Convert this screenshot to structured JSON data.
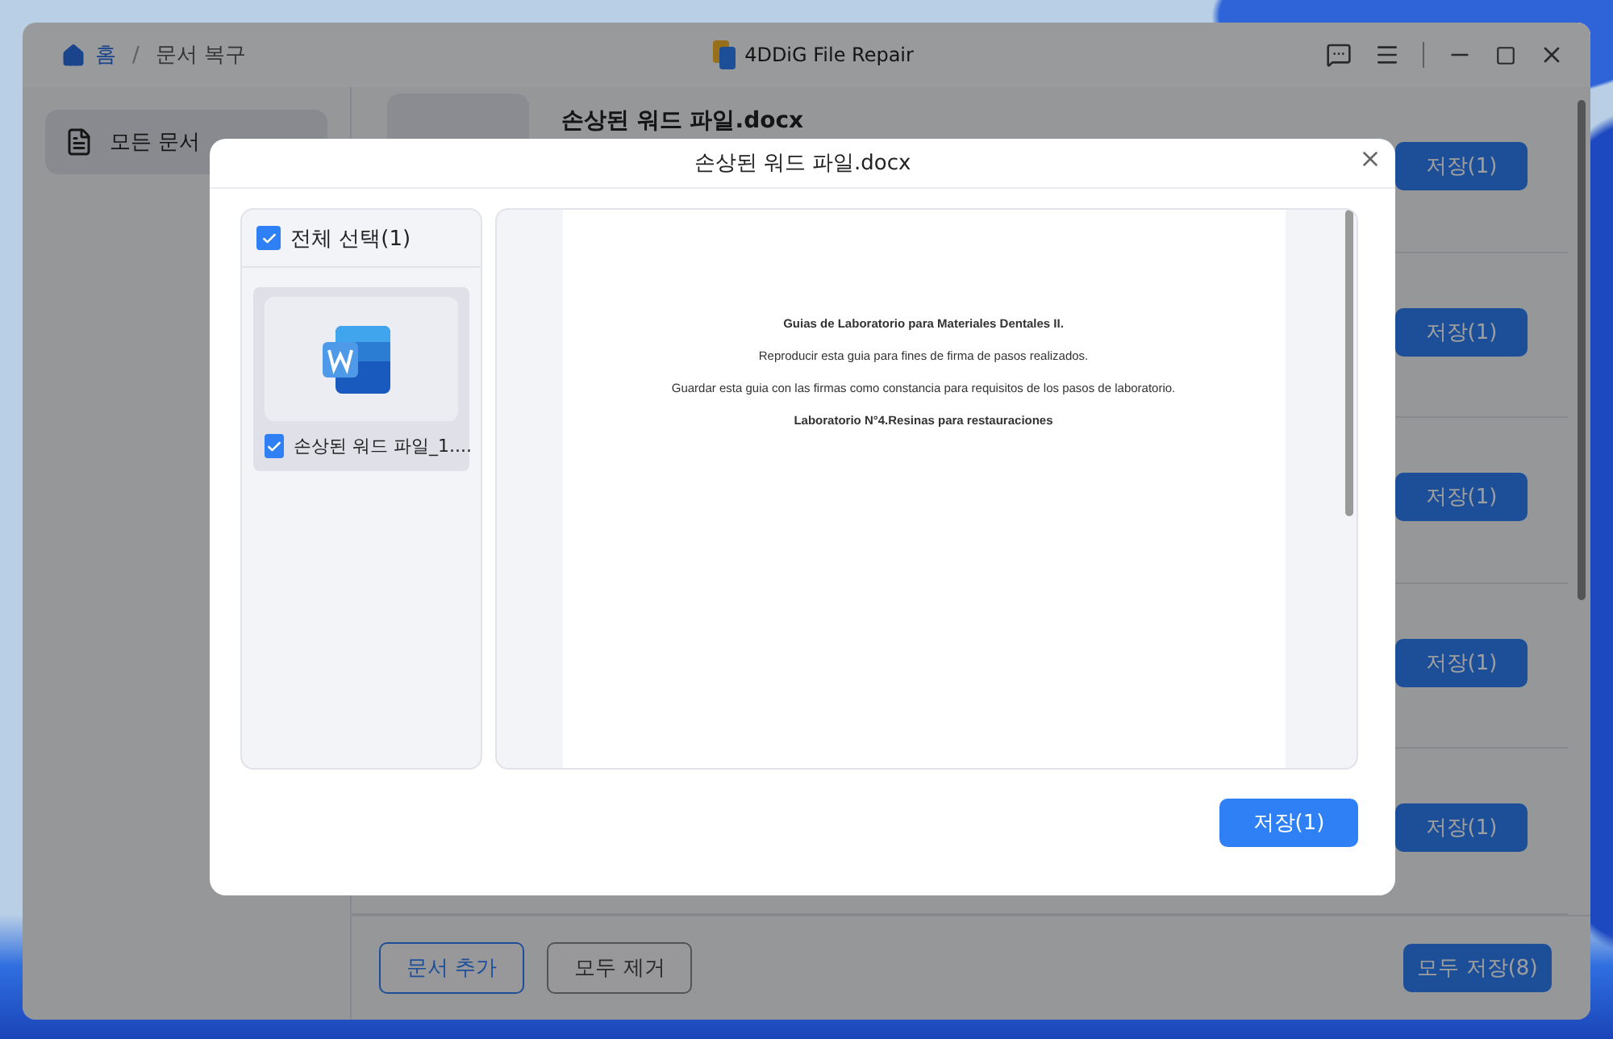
{
  "window": {
    "title": "4DDiG File Repair",
    "breadcrumb": {
      "home": "홈",
      "separator": "/",
      "current": "문서 복구"
    }
  },
  "sidebar": {
    "items": [
      {
        "label": "모든 문서",
        "selected": true
      }
    ]
  },
  "files": [
    {
      "name": "손상된 워드 파일.docx",
      "button": "저장(1)"
    },
    {
      "button": "저장(1)"
    },
    {
      "button": "저장(1)"
    },
    {
      "button": "저장(1)"
    },
    {
      "button": "저장(1)"
    }
  ],
  "footer": {
    "add": "문서 추가",
    "remove": "모두 제거",
    "save_all": "모두 저장(8)"
  },
  "dialog": {
    "title": "손상된 워드 파일.docx",
    "select_all": {
      "label": "전체 선택(1)",
      "checked": true
    },
    "items": [
      {
        "name": "손상된 워드 파일_1....",
        "checked": true,
        "selected": true
      }
    ],
    "document": [
      {
        "text": "Guias de Laboratorio para Materiales Dentales II.",
        "bold": true
      },
      {
        "text": "Reproducir esta guia para fines de firma de pasos realizados.",
        "bold": false
      },
      {
        "text": "Guardar esta guia con las firmas como constancia para requisitos de los pasos de laboratorio.",
        "bold": false
      },
      {
        "text": "Laboratorio N°4.Resinas para restauraciones",
        "bold": true
      }
    ],
    "save": "저장(1)"
  }
}
